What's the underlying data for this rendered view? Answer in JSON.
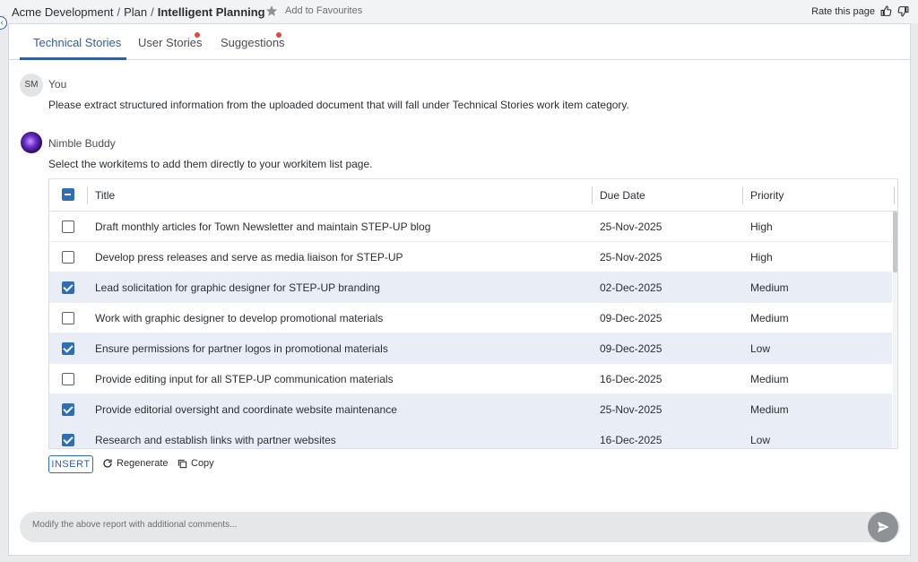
{
  "breadcrumb": {
    "items": [
      "Acme Development",
      "Plan"
    ],
    "current": "Intelligent Planning",
    "favourite_label": "Add to Favourites"
  },
  "rate": {
    "label": "Rate this page"
  },
  "tabs": [
    {
      "label": "Technical Stories",
      "active": true,
      "notification": false
    },
    {
      "label": "User Stories",
      "active": false,
      "notification": true
    },
    {
      "label": "Suggestions",
      "active": false,
      "notification": true
    }
  ],
  "conversation": {
    "user": {
      "initials": "SM",
      "name": "You",
      "message": "Please extract structured information from the uploaded document that will fall under Technical Stories work item category."
    },
    "bot": {
      "name": "Nimble Buddy",
      "message": "Select the workitems to add them directly to your workitem list page."
    }
  },
  "table": {
    "columns": [
      "Title",
      "Due Date",
      "Priority"
    ],
    "rows": [
      {
        "selected": false,
        "title": "Draft monthly articles for Town Newsletter and maintain STEP-UP blog",
        "due": "25-Nov-2025",
        "priority": "High"
      },
      {
        "selected": false,
        "title": "Develop press releases and serve as media liaison for STEP-UP",
        "due": "25-Nov-2025",
        "priority": "High"
      },
      {
        "selected": true,
        "title": "Lead solicitation for graphic designer for STEP-UP branding",
        "due": "02-Dec-2025",
        "priority": "Medium"
      },
      {
        "selected": false,
        "title": "Work with graphic designer to develop promotional materials",
        "due": "09-Dec-2025",
        "priority": "Medium"
      },
      {
        "selected": true,
        "title": "Ensure permissions for partner logos in promotional materials",
        "due": "09-Dec-2025",
        "priority": "Low"
      },
      {
        "selected": false,
        "title": "Provide editing input for all STEP-UP communication materials",
        "due": "16-Dec-2025",
        "priority": "Medium"
      },
      {
        "selected": true,
        "title": "Provide editorial oversight and coordinate website maintenance",
        "due": "25-Nov-2025",
        "priority": "Medium"
      },
      {
        "selected": true,
        "title": "Research and establish links with partner websites",
        "due": "16-Dec-2025",
        "priority": "Low"
      }
    ]
  },
  "actions": {
    "insert_label": "INSERT",
    "regenerate_label": "Regenerate",
    "copy_label": "Copy"
  },
  "composer": {
    "value": "",
    "placeholder": "Modify the above report with additional comments..."
  },
  "colors": {
    "accent": "#2f5f9e",
    "checkbox": "#2f6db5",
    "selected_row": "#e9eef6",
    "notification_dot": "#e04a3b"
  },
  "icons": [
    "star-icon",
    "thumbs-up-icon",
    "thumbs-down-icon",
    "collapse-icon",
    "regenerate-icon",
    "copy-icon",
    "send-icon"
  ]
}
